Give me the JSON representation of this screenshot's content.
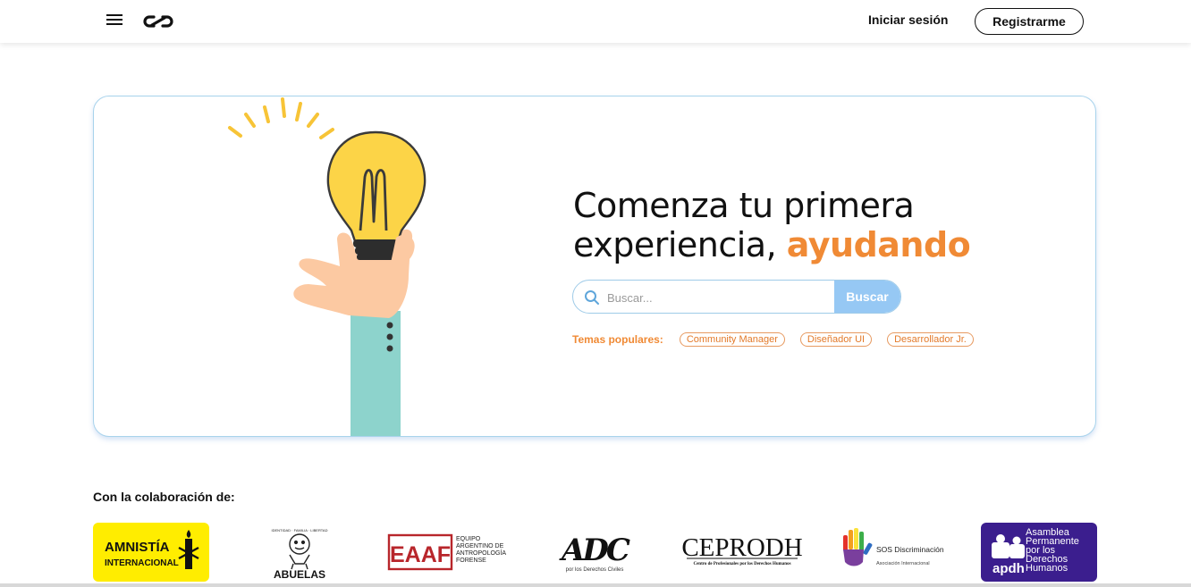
{
  "header": {
    "login_label": "Iniciar sesión",
    "register_label": "Registrarme"
  },
  "hero": {
    "title_line1": "Comenza tu primera",
    "title_line2": "experiencia,",
    "title_accent": "ayudando",
    "search_placeholder": "Buscar...",
    "search_button_label": "Buscar",
    "popular_label": "Temas populares:",
    "popular_topics": [
      "Community Manager",
      "Diseñador UI",
      "Desarrollador Jr."
    ]
  },
  "collaborations": {
    "title": "Con la colaboración de:",
    "partners": [
      {
        "name": "AMNISTÍA",
        "subname": "INTERNACIONAL"
      },
      {
        "name": "ABUELAS",
        "motto": "IDENTIDAD · FAMILIA · LIBERTAD"
      },
      {
        "name": "EAAF",
        "subname": "EQUIPO ARGENTINO DE ANTROPOLOGÍA FORENSE"
      },
      {
        "name": "ADC",
        "subname": "por los Derechos Civiles"
      },
      {
        "name": "CEPRODH",
        "subname": "Centro de Profesionales por los Derechos Humanos"
      },
      {
        "name": "SOS Discriminación",
        "subname": "Asociación Internacional"
      },
      {
        "name": "apdh",
        "subname": "Asamblea Permanente por los Derechos Humanos"
      }
    ]
  },
  "colors": {
    "accent_orange": "#f08a35",
    "search_button": "#96c8f4",
    "card_border": "#a8d3ec"
  }
}
